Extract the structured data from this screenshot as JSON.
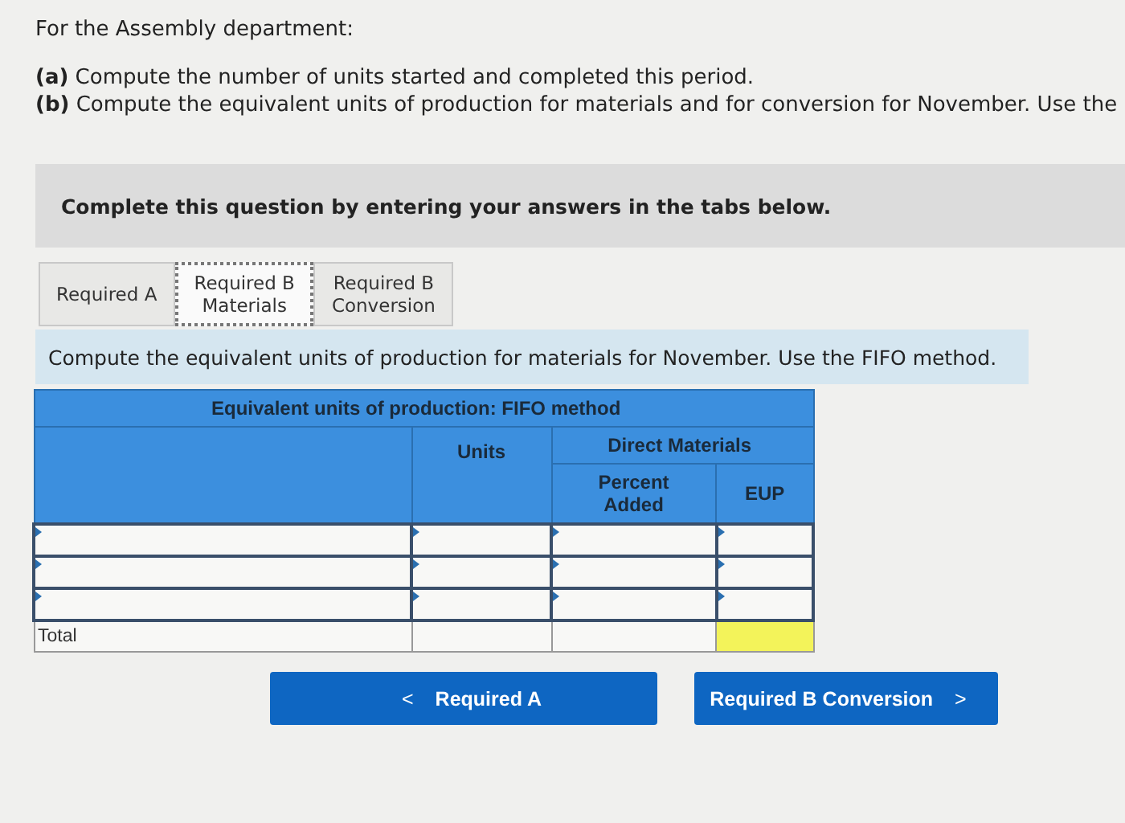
{
  "intro": {
    "heading": "For the Assembly department:",
    "parts": [
      {
        "label": "(a)",
        "text": "Compute the number of units started and completed this period."
      },
      {
        "label": "(b)",
        "text": "Compute the equivalent units of production for materials and for conversion for November. Use the"
      }
    ]
  },
  "banner": "Complete this question by entering your answers in the tabs below.",
  "tabs": [
    {
      "label": "Required A",
      "selected": false
    },
    {
      "label": "Required B\nMaterials",
      "selected": true
    },
    {
      "label": "Required B\nConversion",
      "selected": false
    }
  ],
  "instruction": "Compute the equivalent units of production for materials for November. Use the FIFO method.",
  "table": {
    "title": "Equivalent units of production: FIFO method",
    "col_units": "Units",
    "group": "Direct Materials",
    "col_percent": "Percent\nAdded",
    "col_eup": "EUP",
    "rows": [
      {
        "kind": "entry"
      },
      {
        "kind": "entry"
      },
      {
        "kind": "entry"
      },
      {
        "kind": "total",
        "label": "Total",
        "eup_highlighted": true
      }
    ]
  },
  "nav": {
    "prev": {
      "arrow": "<",
      "label": "Required A"
    },
    "next": {
      "label": "Required B Conversion",
      "arrow": ">"
    }
  }
}
